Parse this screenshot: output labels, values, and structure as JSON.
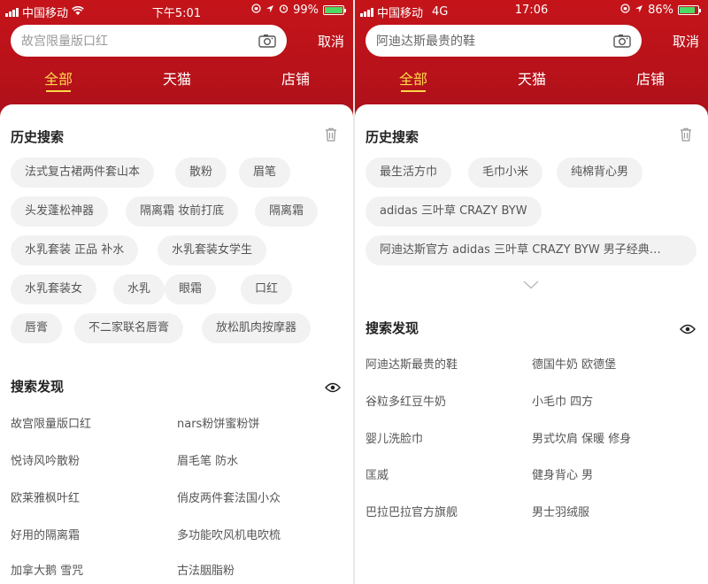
{
  "left": {
    "status": {
      "carrier": "中国移动",
      "time": "下午5:01",
      "battery": "99%",
      "battery_level": 0.99
    },
    "search": {
      "placeholder": "故宫限量版口红",
      "cancel": "取消"
    },
    "tabs": [
      {
        "label": "全部"
      },
      {
        "label": "天猫"
      },
      {
        "label": "店铺"
      }
    ],
    "history": {
      "title": "历史搜索",
      "chips": [
        "法式复古裙两件套山本",
        "散粉",
        "眉笔",
        "头发蓬松神器",
        "隔离霜 妆前打底",
        "隔离霜",
        "水乳套装 正品 补水",
        "水乳套装女学生",
        "水乳套装女",
        "水乳",
        "眼霜",
        "口红",
        "唇膏",
        "不二家联名唇膏",
        "放松肌肉按摩器"
      ]
    },
    "discover": {
      "title": "搜索发现",
      "items": [
        "故宫限量版口红",
        "nars粉饼蜜粉饼",
        "悦诗风吟散粉",
        "眉毛笔 防水",
        "欧莱雅枫叶红",
        "俏皮两件套法国小众",
        "好用的隔离霜",
        "多功能吹风机电吹梳",
        "加拿大鹅 雪咒",
        "古法胭脂粉"
      ]
    }
  },
  "right": {
    "status": {
      "carrier": "中国移动",
      "network": "4G",
      "time": "17:06",
      "battery": "86%",
      "battery_level": 0.86
    },
    "search": {
      "placeholder": "阿迪达斯最贵的鞋",
      "cancel": "取消"
    },
    "tabs": [
      {
        "label": "全部"
      },
      {
        "label": "天猫"
      },
      {
        "label": "店铺"
      }
    ],
    "history": {
      "title": "历史搜索",
      "chips": [
        "最生活方巾",
        "毛巾小米",
        "纯棉背心男",
        "adidas 三叶草 CRAZY BYW",
        "阿迪达斯官方 adidas 三叶草 CRAZY BYW 男子经典…"
      ]
    },
    "discover": {
      "title": "搜索发现",
      "items": [
        "阿迪达斯最贵的鞋",
        "德国牛奶 欧德堡",
        "谷粒多红豆牛奶",
        "小毛巾 四方",
        "婴儿洗脸巾",
        "男式坎肩 保暖 修身",
        "匡威",
        "健身背心 男",
        "巴拉巴拉官方旗舰",
        "男士羽绒服"
      ]
    }
  },
  "colors": {
    "header_red": "#c4141a",
    "tab_active": "#ffd84a",
    "chip_bg": "#f2f2f2"
  }
}
